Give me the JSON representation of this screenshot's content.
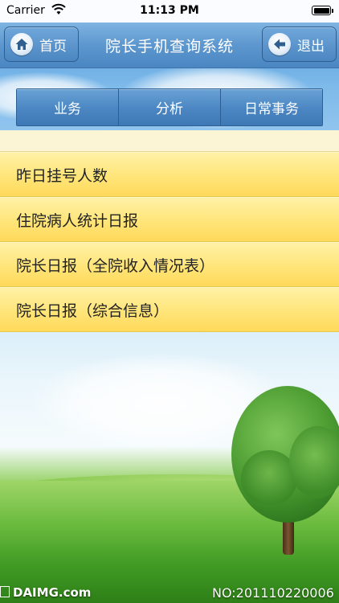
{
  "status_bar": {
    "carrier": "Carrier",
    "time": "11:13 PM"
  },
  "navbar": {
    "home_label": "首页",
    "title": "院长手机查询系统",
    "back_label": "退出"
  },
  "tabs": [
    "业务",
    "分析",
    "日常事务"
  ],
  "menu_items": [
    "昨日挂号人数",
    "住院病人统计日报",
    "院长日报（全院收入情况表）",
    "院长日报（综合信息）"
  ],
  "footer": {
    "brand": "DAIMG.com",
    "serial": "NO:201110220006"
  },
  "colors": {
    "nav_blue": "#4a86c2",
    "list_yellow": "#ffe579"
  }
}
